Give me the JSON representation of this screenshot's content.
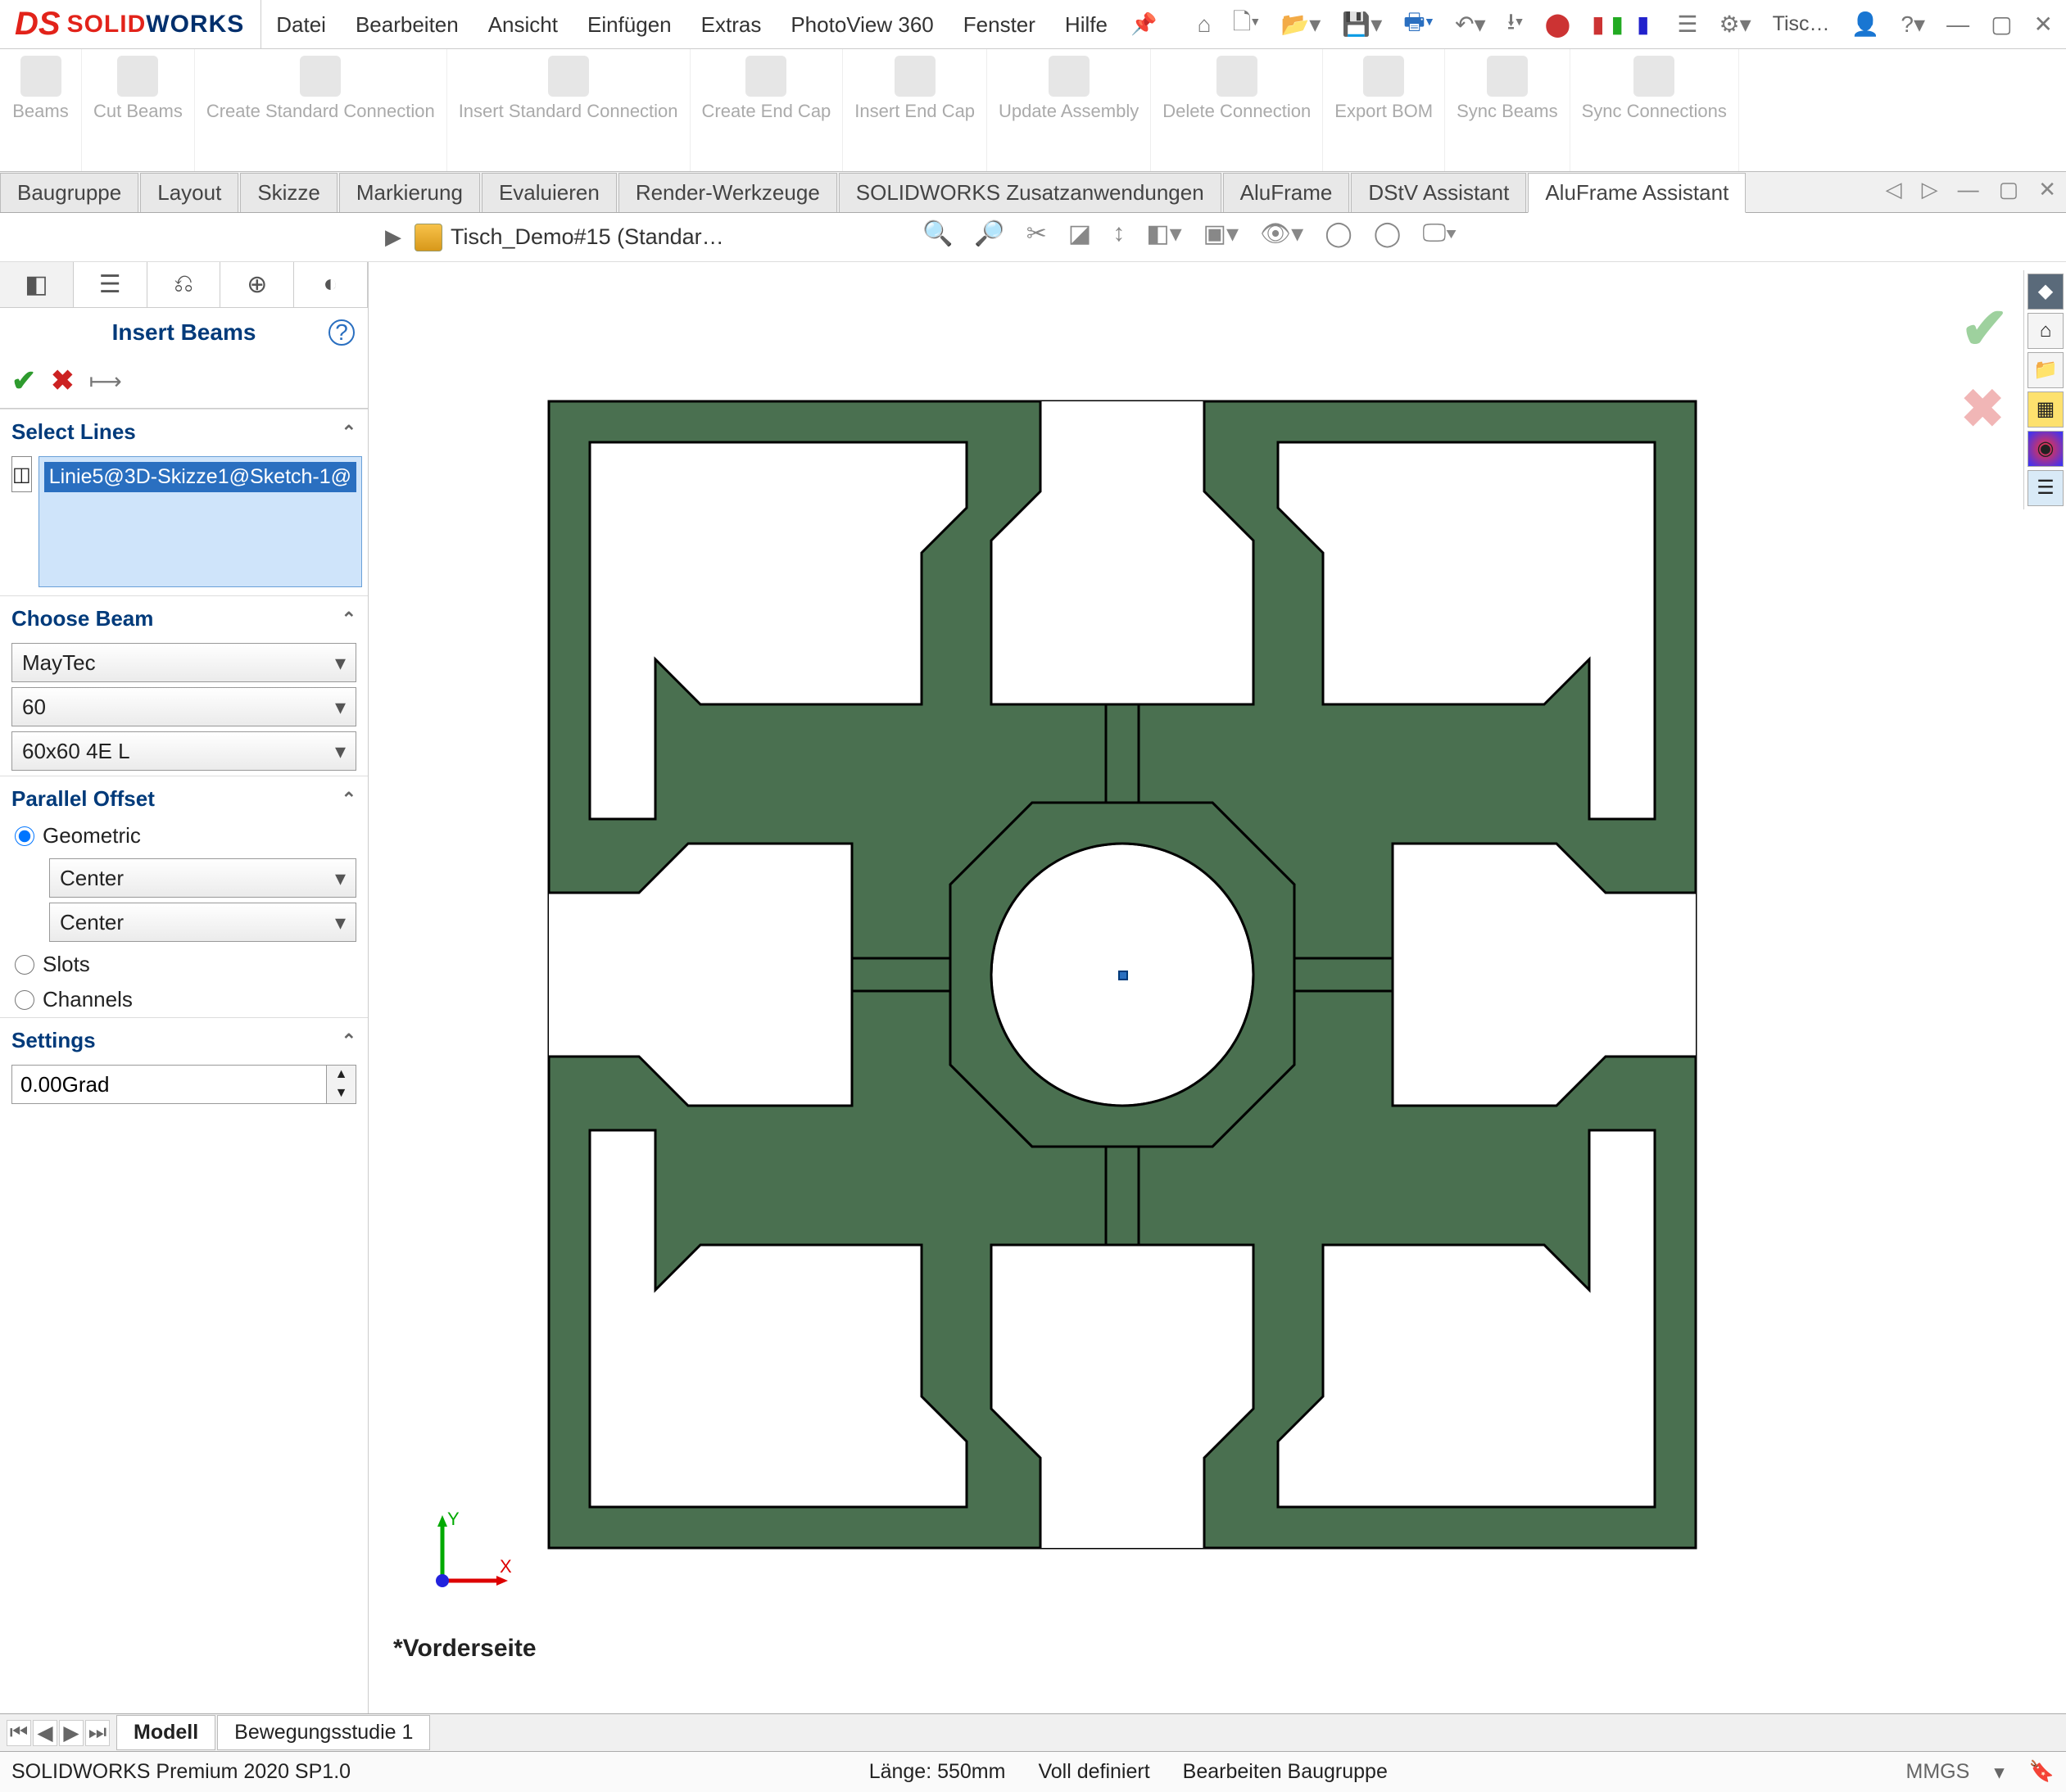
{
  "menubar": {
    "items": [
      "Datei",
      "Bearbeiten",
      "Ansicht",
      "Einfügen",
      "Extras",
      "PhotoView 360",
      "Fenster",
      "Hilfe"
    ],
    "search_text": "Tisc…"
  },
  "ribbon": [
    {
      "label": "Beams"
    },
    {
      "label": "Cut Beams"
    },
    {
      "label": "Create Standard Connection"
    },
    {
      "label": "Insert Standard Connection"
    },
    {
      "label": "Create End Cap"
    },
    {
      "label": "Insert End Cap"
    },
    {
      "label": "Update Assembly"
    },
    {
      "label": "Delete Connection"
    },
    {
      "label": "Export BOM"
    },
    {
      "label": "Sync Beams"
    },
    {
      "label": "Sync Connections"
    }
  ],
  "tabs": [
    "Baugruppe",
    "Layout",
    "Skizze",
    "Markierung",
    "Evaluieren",
    "Render-Werkzeuge",
    "SOLIDWORKS Zusatzanwendungen",
    "AluFrame",
    "DStV Assistant",
    "AluFrame Assistant"
  ],
  "active_tab_index": 9,
  "breadcrumb": "Tisch_Demo#15  (Standar…",
  "panel": {
    "title": "Insert Beams",
    "sections": {
      "select_lines": {
        "title": "Select Lines",
        "item": "Linie5@3D-Skizze1@Sketch-1@"
      },
      "choose_beam": {
        "title": "Choose Beam",
        "vendor": "MayTec",
        "size": "60",
        "profile": "60x60 4E L"
      },
      "parallel_offset": {
        "title": "Parallel Offset",
        "mode_geometric": "Geometric",
        "mode_slots": "Slots",
        "mode_channels": "Channels",
        "axis1": "Center",
        "axis2": "Center"
      },
      "settings": {
        "title": "Settings",
        "value": "0.00Grad"
      }
    }
  },
  "viewport": {
    "view_label": "*Vorderseite"
  },
  "bottom_tabs": {
    "model": "Modell",
    "motion": "Bewegungsstudie 1"
  },
  "status": {
    "version": "SOLIDWORKS Premium 2020 SP1.0",
    "length": "Länge: 550mm",
    "defined": "Voll definiert",
    "mode": "Bearbeiten Baugruppe",
    "units": "MMGS"
  }
}
